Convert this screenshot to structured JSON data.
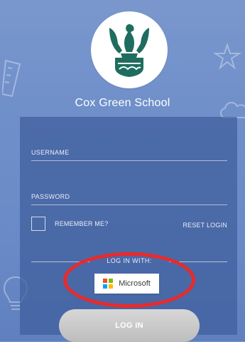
{
  "school": {
    "name": "Cox Green School"
  },
  "form": {
    "username_label": "USERNAME",
    "password_label": "PASSWORD",
    "remember_label": "REMEMBER ME?",
    "reset_login_label": "RESET LOGIN",
    "login_with_label": "LOG IN WITH:",
    "microsoft_label": "Microsoft",
    "login_button_label": "LOG IN"
  },
  "icons": {
    "logo": "eagle-crest-icon",
    "microsoft": "microsoft-logo-icon",
    "checkbox": "checkbox-icon"
  },
  "colors": {
    "background": "#6f8fca",
    "panel": "#3e5d9b",
    "crest_green": "#1f6d5e",
    "microsoft_red": "#f25022",
    "microsoft_green": "#7fba00",
    "microsoft_blue": "#00a4ef",
    "microsoft_yellow": "#ffb900",
    "highlight": "#ea2a2a"
  }
}
